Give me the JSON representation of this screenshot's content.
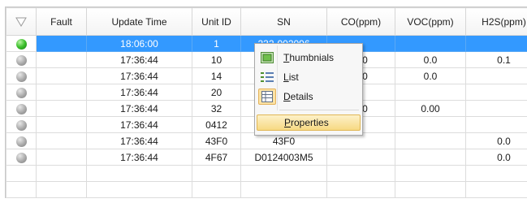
{
  "grid": {
    "columns": [
      "",
      "Fault",
      "Update Time",
      "Unit ID",
      "SN",
      "CO(ppm)",
      "VOC(ppm)",
      "H2S(ppm)"
    ],
    "rows": [
      {
        "status": "green",
        "fault": "",
        "time": "18:06:00",
        "unit": "1",
        "sn": "232-002096",
        "co": "",
        "voc": "",
        "h2s": "",
        "selected": true
      },
      {
        "status": "grey",
        "fault": "",
        "time": "17:36:44",
        "unit": "10",
        "sn": "",
        "co": "0.0",
        "voc": "0.0",
        "h2s": "0.1"
      },
      {
        "status": "grey",
        "fault": "",
        "time": "17:36:44",
        "unit": "14",
        "sn": "",
        "co": "0.0",
        "voc": "0.0",
        "h2s": ""
      },
      {
        "status": "grey",
        "fault": "",
        "time": "17:36:44",
        "unit": "20",
        "sn": "",
        "co": "",
        "voc": "",
        "h2s": ""
      },
      {
        "status": "grey",
        "fault": "",
        "time": "17:36:44",
        "unit": "32",
        "sn": "",
        "co": "0.0",
        "voc": "0.00",
        "h2s": ""
      },
      {
        "status": "grey",
        "fault": "",
        "time": "17:36:44",
        "unit": "0412",
        "sn": "",
        "co": "",
        "voc": "",
        "h2s": ""
      },
      {
        "status": "grey",
        "fault": "",
        "time": "17:36:44",
        "unit": "43F0",
        "sn": "43F0",
        "co": "",
        "voc": "",
        "h2s": "0.0"
      },
      {
        "status": "grey",
        "fault": "",
        "time": "17:36:44",
        "unit": "4F67",
        "sn": "D0124003M5",
        "co": "",
        "voc": "",
        "h2s": "0.0"
      }
    ],
    "empty_rows": 2
  },
  "context_menu": {
    "items": [
      {
        "label": "Thumbnials",
        "accel": "T",
        "rest": "humbnials",
        "icon": "thumbnails-icon"
      },
      {
        "label": "List",
        "accel": "L",
        "rest": "ist",
        "icon": "list-icon"
      },
      {
        "label": "Details",
        "accel": "D",
        "rest": "etails",
        "icon": "details-icon",
        "checked": true
      },
      {
        "label": "Properties",
        "accel": "P",
        "rest": "roperties",
        "hover": true
      }
    ]
  },
  "colors": {
    "selection": "#3399ff",
    "menu_hover": "#f7d983",
    "status_online": "#3cbf2c",
    "status_offline": "#a9a9a9"
  }
}
